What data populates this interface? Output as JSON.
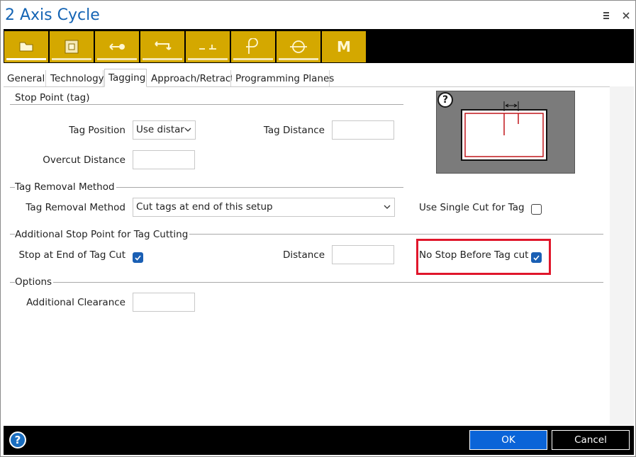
{
  "window": {
    "title": "2 Axis Cycle",
    "menu_icon": "hamburger-icon",
    "close_icon": "close-icon"
  },
  "toolbar": {
    "tools": [
      {
        "icon": "folder-icon"
      },
      {
        "icon": "square-icon"
      },
      {
        "icon": "arrow-dot-icon"
      },
      {
        "icon": "arrows-loop-icon"
      },
      {
        "icon": "step-icon"
      },
      {
        "icon": "lead-in-icon"
      },
      {
        "icon": "circle-line-icon"
      },
      {
        "icon": "m-icon",
        "label": "M"
      }
    ]
  },
  "tabs": [
    "General",
    "Technology",
    "Tagging",
    "Approach/Retract",
    "Programming Planes"
  ],
  "active_tab": "Tagging",
  "stop_point": {
    "group_label": "Stop Point (tag)",
    "tag_position_label": "Tag Position",
    "tag_position_value": "Use distar",
    "tag_distance_label": "Tag Distance",
    "tag_distance_value": "",
    "overcut_distance_label": "Overcut Distance",
    "overcut_distance_value": ""
  },
  "tag_removal": {
    "group_label": "Tag Removal Method",
    "method_label": "Tag Removal Method",
    "method_value": "Cut tags at end of this setup",
    "single_cut_label": "Use Single Cut for Tag",
    "single_cut_checked": false
  },
  "additional_stop": {
    "group_label": "Additional Stop Point for Tag Cutting",
    "stop_end_label": "Stop at End of Tag Cut",
    "stop_end_checked": true,
    "distance_label": "Distance",
    "distance_value": "",
    "no_stop_label": "No Stop Before Tag cut",
    "no_stop_checked": true
  },
  "options": {
    "group_label": "Options",
    "clearance_label": "Additional Clearance",
    "clearance_value": ""
  },
  "diagram": {
    "help_glyph": "?"
  },
  "footer": {
    "help_glyph": "?",
    "ok_label": "OK",
    "cancel_label": "Cancel"
  },
  "colors": {
    "accent": "#1464b4",
    "toolbar_gold": "#d4a800",
    "highlight_red": "#e0162b",
    "checkbox_blue": "#1a5fb4"
  }
}
